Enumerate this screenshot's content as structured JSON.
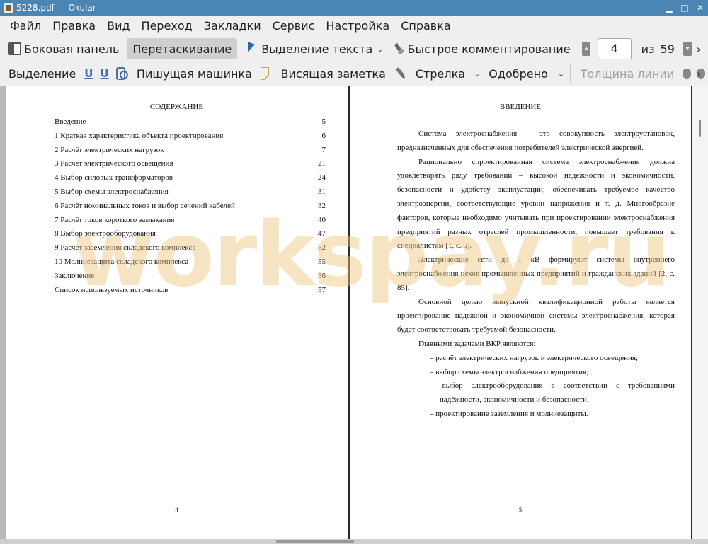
{
  "window": {
    "title": "5228.pdf  — Okular",
    "min_glyph": "▁",
    "max_glyph": "□",
    "close_glyph": "✕"
  },
  "menu": [
    "Файл",
    "Правка",
    "Вид",
    "Переход",
    "Закладки",
    "Сервис",
    "Настройка",
    "Справка"
  ],
  "toolbar1": {
    "sidebar": "Боковая панель",
    "browse": "Перетаскивание",
    "text_select": "Выделение текста",
    "quick_annotate": "Быстрое комментирование",
    "page_current": "4",
    "page_of": "из",
    "page_total": "59"
  },
  "toolbar2": {
    "highlight": "Выделение",
    "underline_glyph": "U",
    "squiggle_glyph": "U",
    "typewriter": "Пишущая машинка",
    "popup_note": "Висящая заметка",
    "arrow": "Стрелка",
    "stamp": "Одобрено",
    "line_width": "Толщина линии"
  },
  "glyphs": {
    "chevron_down": "⌄",
    "overflow": "›"
  },
  "page_left": {
    "title": "СОДЕРЖАНИЕ",
    "toc": [
      {
        "label": "Введение",
        "page": "5"
      },
      {
        "label": "1 Краткая характеристика объекта проектирования",
        "page": "6"
      },
      {
        "label": "2 Расчёт электрических нагрузок",
        "page": "7"
      },
      {
        "label": "3 Расчёт электрического освещения",
        "page": "21"
      },
      {
        "label": "4 Выбор силовых трансформаторов",
        "page": "24"
      },
      {
        "label": "5 Выбор схемы электроснабжения",
        "page": "31"
      },
      {
        "label": "6 Расчёт номинальных токов и выбор сечений кабелей",
        "page": "32"
      },
      {
        "label": "7 Расчёт токов короткого замыкания",
        "page": "40"
      },
      {
        "label": "8 Выбор электрооборудования",
        "page": "47"
      },
      {
        "label": "9 Расчёт заземления складского комплекса",
        "page": "52"
      },
      {
        "label": "10 Молниезащита складского комплекса",
        "page": "55"
      },
      {
        "label": "Заключение",
        "page": "56"
      },
      {
        "label": "Список используемых источников",
        "page": "57"
      }
    ],
    "page_number": "4"
  },
  "page_right": {
    "title": "ВВЕДЕНИЕ",
    "p1": "Система электроснабжения – это совокупность электроустановок, предназначенных для обеспечения потребителей электрической энергией.",
    "p2": "Рационально спроектированная система электроснабжения должна удовлетворять ряду требований – высокой надёжности и экономичности, безопасности и удобству эксплуатации; обеспечивать требуемое качество электроэнергии, соответствующие уровни напряжения и т. д. Многообразие факторов, которые необходимо учитывать при проектировании электроснабжения предприятий разных отраслей промышленности, повышает требования к специалистам [1, с. 5].",
    "p3": "Электрические сети до 1 кВ формируют системы внутреннего электроснабжения цехов промышленных предприятий и гражданских зданий [2, с. 85].",
    "p4": "Основной целью выпускной квалификационной работы является проектирование надёжной и экономичной системы электроснабжения, которая будет соответствовать требуемой безопасности.",
    "p5": "Главными задачами ВКР являются:",
    "tasks": [
      "расчёт электрических нагрузок и электрического освещения;",
      "выбор схемы электроснабжения предприятия;",
      "выбор электрооборудования в соответствии с требованиями надёжности, экономичности и безопасности;",
      "проектирование заземления и молниезащиты."
    ],
    "page_number": "5"
  },
  "watermark": "workspay.ru"
}
